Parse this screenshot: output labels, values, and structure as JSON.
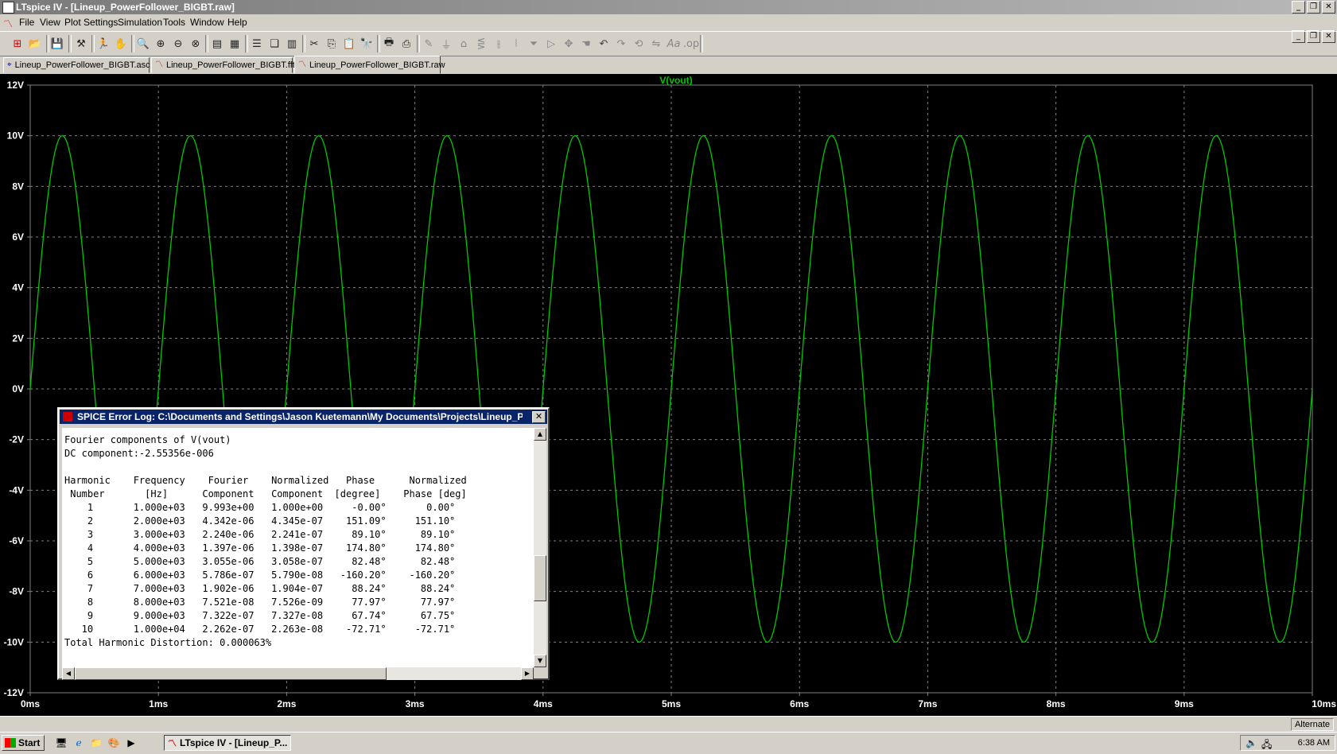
{
  "window": {
    "title": "LTspice IV - [Lineup_PowerFollower_BIGBT.raw]"
  },
  "menu": [
    {
      "label": "File"
    },
    {
      "label": "View"
    },
    {
      "label": "Plot Settings"
    },
    {
      "label": "Simulation"
    },
    {
      "label": "Tools"
    },
    {
      "label": "Window"
    },
    {
      "label": "Help"
    }
  ],
  "tabs": [
    {
      "label": "Lineup_PowerFollower_BIGBT.asc"
    },
    {
      "label": "Lineup_PowerFollower_BIGBT.fft"
    },
    {
      "label": "Lineup_PowerFollower_BIGBT.raw"
    }
  ],
  "colors": {
    "trace": "#00c800",
    "grid": "#808080",
    "axis_text": "#ffffff",
    "background": "#000000"
  },
  "chart_data": {
    "type": "line",
    "title": "V(vout)",
    "x_ticks": [
      "0ms",
      "1ms",
      "2ms",
      "3ms",
      "4ms",
      "5ms",
      "6ms",
      "7ms",
      "8ms",
      "9ms",
      "10ms"
    ],
    "y_ticks": [
      "12V",
      "10V",
      "8V",
      "6V",
      "4V",
      "2V",
      "0V",
      "-2V",
      "-4V",
      "-6V",
      "-8V",
      "-10V",
      "-12V"
    ],
    "xlim": [
      0,
      10
    ],
    "ylim": [
      -12,
      12
    ],
    "x_unit": "ms",
    "series": [
      {
        "name": "V(vout)",
        "waveform": "sine",
        "amplitude": 10,
        "frequency_khz": 1,
        "offset": 0
      }
    ],
    "grid": true
  },
  "error_log": {
    "title": "SPICE Error Log: C:\\Documents and Settings\\Jason Kuetemann\\My Documents\\Projects\\Lineup_Po...",
    "heading": "Fourier components of V(vout)",
    "dc": "DC component:-2.55356e-006",
    "header1": "Harmonic    Frequency    Fourier    Normalized   Phase      Normalized",
    "header2": " Number       [Hz]      Component   Component  [degree]    Phase [deg]",
    "rows": [
      "    1       1.000e+03   9.993e+00   1.000e+00     -0.00°       0.00°",
      "    2       2.000e+03   4.342e-06   4.345e-07    151.09°     151.10°",
      "    3       3.000e+03   2.240e-06   2.241e-07     89.10°      89.10°",
      "    4       4.000e+03   1.397e-06   1.398e-07    174.80°     174.80°",
      "    5       5.000e+03   3.055e-06   3.058e-07     82.48°      82.48°",
      "    6       6.000e+03   5.786e-07   5.790e-08   -160.20°    -160.20°",
      "    7       7.000e+03   1.902e-06   1.904e-07     88.24°      88.24°",
      "    8       8.000e+03   7.521e-08   7.526e-09     77.97°      77.97°",
      "    9       9.000e+03   7.322e-07   7.327e-08     67.74°      67.75°",
      "   10       1.000e+04   2.262e-07   2.263e-08    -72.71°     -72.71°"
    ],
    "thd": "Total Harmonic Distortion: 0.000063%"
  },
  "status": {
    "mode": "Alternate"
  },
  "taskbar": {
    "start": "Start",
    "task": "LTspice IV - [Lineup_P...",
    "clock": "6:38 AM"
  }
}
